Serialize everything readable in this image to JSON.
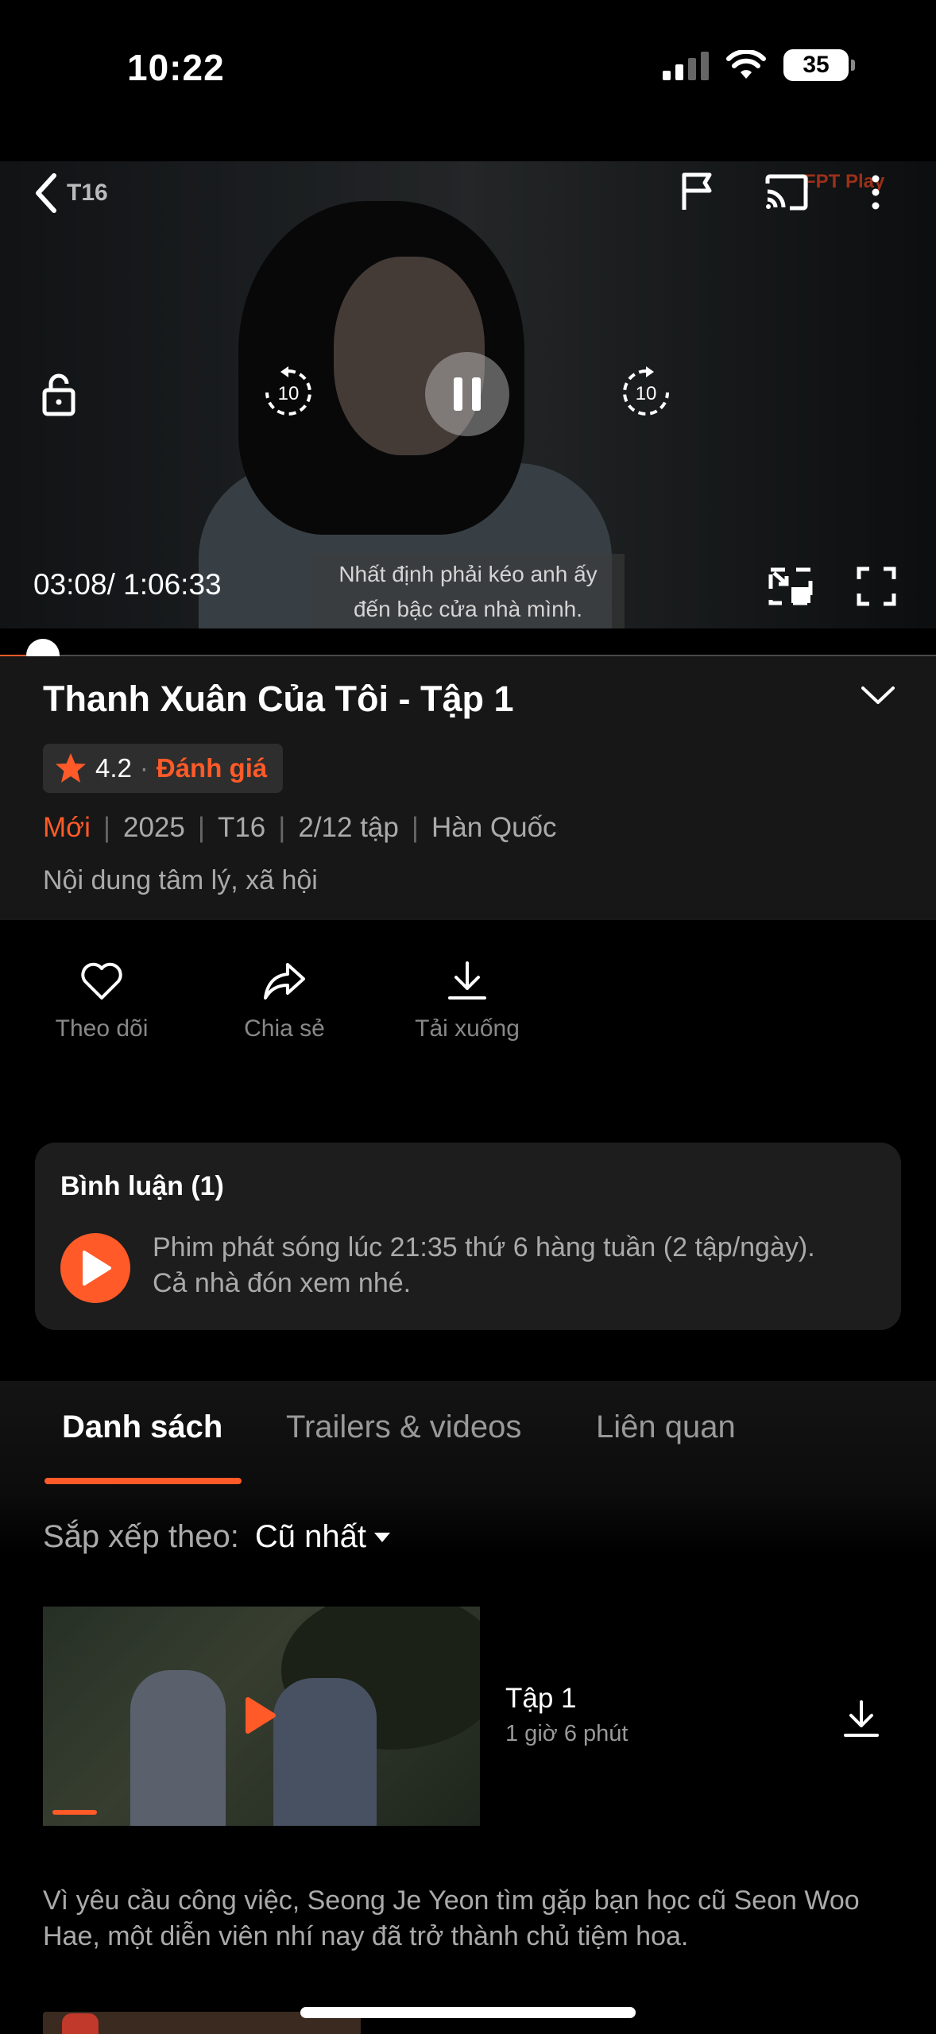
{
  "status_bar": {
    "time": "10:22",
    "battery": "35"
  },
  "player": {
    "rating_tag": "T16",
    "watermark": "FPT Play",
    "current_time": "03:08",
    "total_time": "/ 1:06:33",
    "subtitle_line1": "Nhất định phải kéo anh ấy",
    "subtitle_line2": "đến bậc cửa nhà mình.",
    "progress": 0.046
  },
  "info": {
    "title": "Thanh Xuân Của Tôi - Tập 1",
    "rating": "4.2",
    "rating_sep": "·",
    "rate_link": "Đánh giá",
    "meta_new": "Mới",
    "meta_year": "2025",
    "meta_age": "T16",
    "meta_episodes": "2/12 tập",
    "meta_country": "Hàn Quốc",
    "meta_sep": "|",
    "genre": "Nội dung tâm lý, xã hội"
  },
  "actions": {
    "follow": "Theo dõi",
    "share": "Chia sẻ",
    "download": "Tải xuống"
  },
  "comments": {
    "title": "Bình luận (1)",
    "text_line1": "Phim phát sóng lúc 21:35 thứ 6 hàng tuần (2 tập/ngày).",
    "text_line2": "Cả nhà đón xem nhé."
  },
  "tabs": {
    "list": "Danh sách",
    "trailers": "Trailers & videos",
    "related": "Liên quan"
  },
  "sort": {
    "label": "Sắp xếp theo:",
    "value": "Cũ nhất"
  },
  "episode": {
    "title": "Tập 1",
    "duration": "1 giờ 6 phút",
    "description": "Vì yêu cầu công việc, Seong Je Yeon tìm gặp bạn học cũ Seon Woo Hae, một diễn viên nhí nay đã trở thành chủ tiệm hoa."
  },
  "colors": {
    "accent": "#ff5a28",
    "card": "#1d1d1d",
    "info_bg": "#171717"
  }
}
